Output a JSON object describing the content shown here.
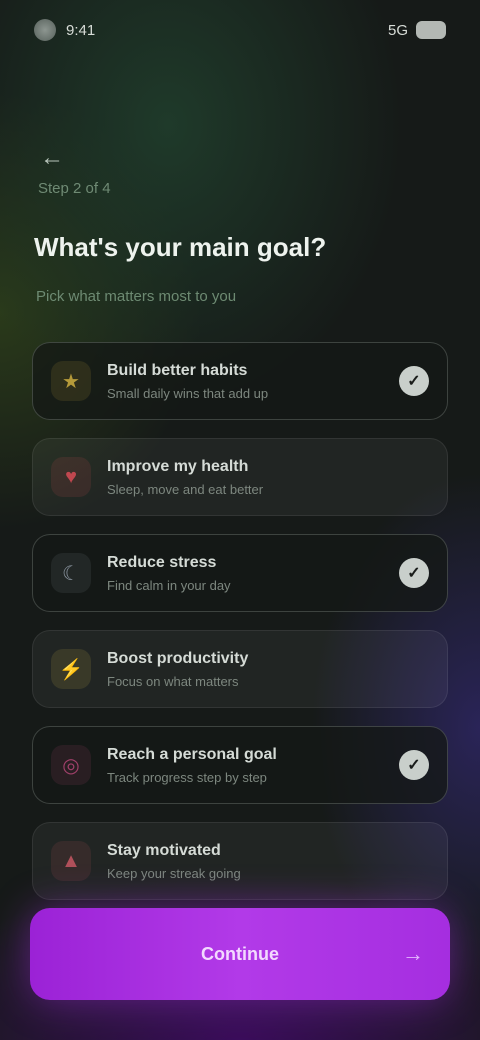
{
  "status_bar": {
    "time": "9:41",
    "signal": "5G"
  },
  "header": {
    "back_glyph": "←",
    "step": "Step 2 of 4",
    "title": "What's your main goal?",
    "subtitle": "Pick what matters most to you"
  },
  "options": [
    {
      "icon": "star-icon",
      "glyph": "★",
      "icon_color": "#b59a3a",
      "icon_bg": "rgba(181,154,58,0.15)",
      "title": "Build better habits",
      "desc": "Small daily wins that add up",
      "selected": true
    },
    {
      "icon": "heart-icon",
      "glyph": "♥",
      "icon_color": "#c0474f",
      "icon_bg": "rgba(192,71,79,0.15)",
      "title": "Improve my health",
      "desc": "Sleep, move and eat better",
      "selected": false
    },
    {
      "icon": "moon-icon",
      "glyph": "☾",
      "icon_color": "#8b95a0",
      "icon_bg": "rgba(139,149,160,0.12)",
      "title": "Reduce stress",
      "desc": "Find calm in your day",
      "selected": true
    },
    {
      "icon": "bolt-icon",
      "glyph": "⚡",
      "icon_color": "#c4b04a",
      "icon_bg": "rgba(196,176,74,0.15)",
      "title": "Boost productivity",
      "desc": "Focus on what matters",
      "selected": false
    },
    {
      "icon": "target-icon",
      "glyph": "◎",
      "icon_color": "#a0406a",
      "icon_bg": "rgba(160,64,106,0.15)",
      "title": "Reach a personal goal",
      "desc": "Track progress step by step",
      "selected": true
    },
    {
      "icon": "flame-icon",
      "glyph": "▲",
      "icon_color": "#b0505a",
      "icon_bg": "rgba(176,80,90,0.15)",
      "title": "Stay motivated",
      "desc": "Keep your streak going",
      "selected": false
    }
  ],
  "footer": {
    "continue_label": "Continue",
    "continue_arrow": "→"
  }
}
